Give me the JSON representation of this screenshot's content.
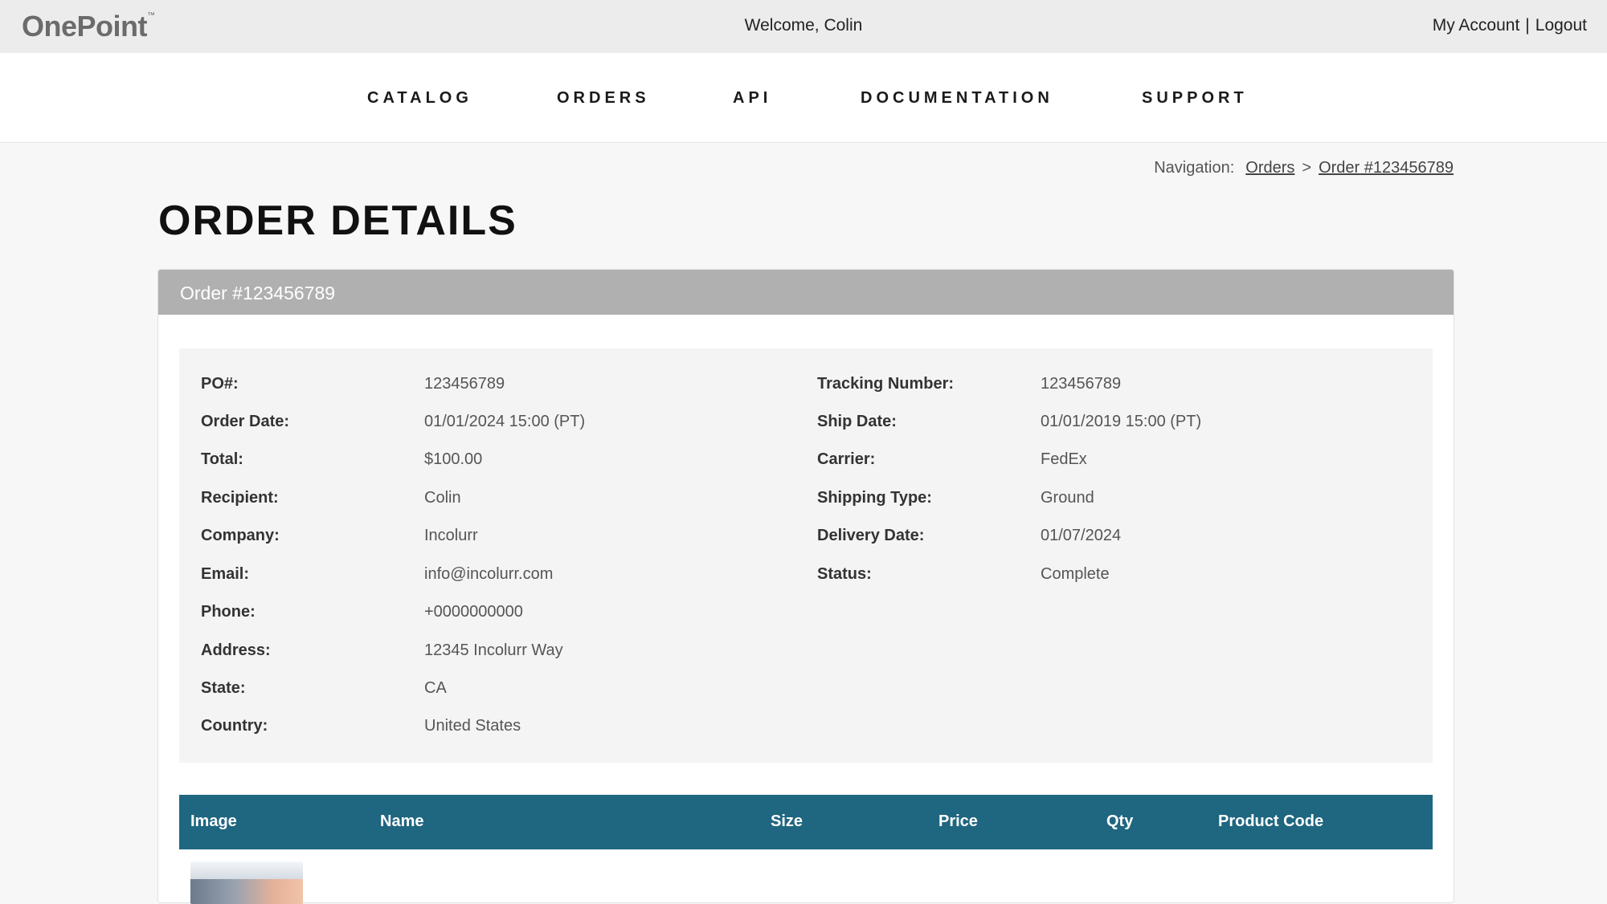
{
  "brand": {
    "name": "OnePoint",
    "tm": "™"
  },
  "topbar": {
    "welcome": "Welcome, Colin",
    "my_account": "My Account",
    "separator": "|",
    "logout": "Logout"
  },
  "nav": {
    "items": [
      "CATALOG",
      "ORDERS",
      "API",
      "DOCUMENTATION",
      "SUPPORT"
    ]
  },
  "breadcrumb": {
    "label": "Navigation:",
    "items": [
      "Orders",
      "Order #123456789"
    ],
    "separator": ">"
  },
  "page": {
    "title": "ORDER DETAILS"
  },
  "order": {
    "header": "Order #123456789",
    "left_fields": [
      {
        "label": "PO#:",
        "value": "123456789"
      },
      {
        "label": "Order Date:",
        "value": "01/01/2024 15:00 (PT)"
      },
      {
        "label": "Total:",
        "value": "$100.00"
      },
      {
        "label": "Recipient:",
        "value": "Colin"
      },
      {
        "label": "Company:",
        "value": "Incolurr"
      },
      {
        "label": "Email:",
        "value": "info@incolurr.com"
      },
      {
        "label": "Phone:",
        "value": "+0000000000"
      },
      {
        "label": "Address:",
        "value": "12345 Incolurr Way"
      },
      {
        "label": "State:",
        "value": "CA"
      },
      {
        "label": "Country:",
        "value": "United States"
      }
    ],
    "right_fields": [
      {
        "label": "Tracking Number:",
        "value": "123456789"
      },
      {
        "label": "Ship Date:",
        "value": "01/01/2019 15:00 (PT)"
      },
      {
        "label": "Carrier:",
        "value": "FedEx"
      },
      {
        "label": "Shipping Type:",
        "value": "Ground"
      },
      {
        "label": "Delivery Date:",
        "value": "01/07/2024"
      },
      {
        "label": "Status:",
        "value": "Complete"
      }
    ]
  },
  "items_table": {
    "columns": [
      "Image",
      "Name",
      "Size",
      "Price",
      "Qty",
      "Product Code"
    ]
  },
  "colors": {
    "table_header": "#1f6680",
    "card_header": "#b0b0b0"
  }
}
